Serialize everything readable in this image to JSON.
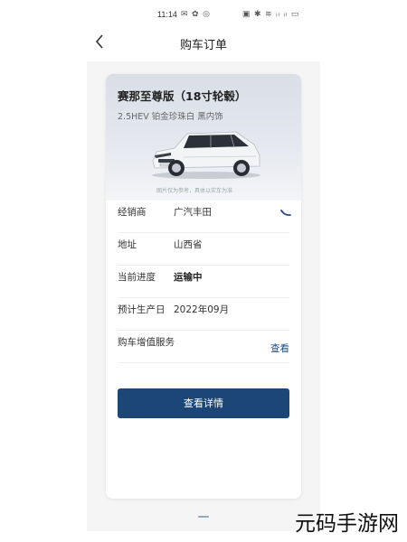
{
  "status_bar": {
    "time": "11:14",
    "left_icons": "✉ ✿ ◎",
    "right_icons": "▣ ✱ ≋ ᵢₗ ᵢₗ ▭"
  },
  "nav": {
    "title": "购车订单"
  },
  "car_card": {
    "title": "赛那至尊版（18寸轮毂）",
    "subtitle": "2.5HEV 铂金珍珠白 黑内饰",
    "disclaimer": "图片仅为参考，具体以实车为准"
  },
  "details": [
    {
      "label": "经销商",
      "value": "广汽丰田"
    },
    {
      "label": "地址",
      "value": "山西省"
    },
    {
      "label": "当前进度",
      "value": "运输中"
    },
    {
      "label": "预计生产日",
      "value": "2022年09月"
    },
    {
      "label": "购车增值服务",
      "link": "查看"
    }
  ],
  "action": {
    "label": "查看详情"
  },
  "watermark": "元码手游网",
  "colors": {
    "primary": "#1c4675",
    "link": "#1e4a86",
    "hero_bg": "#dde2ea"
  }
}
